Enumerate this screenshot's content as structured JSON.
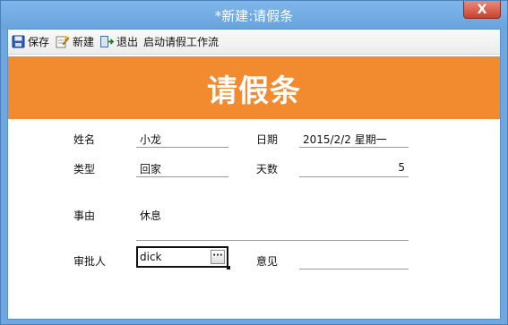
{
  "window": {
    "title": "*新建:请假条",
    "close_label": "X"
  },
  "toolbar": {
    "save_label": "保存",
    "new_label": "新建",
    "exit_label": "退出",
    "start_label": "启动请假工作流"
  },
  "banner": {
    "title": "请假条"
  },
  "form": {
    "name": {
      "label": "姓名",
      "value": "小龙"
    },
    "date": {
      "label": "日期",
      "value": "2015/2/2 星期一"
    },
    "type": {
      "label": "类型",
      "value": "回家"
    },
    "days": {
      "label": "天数",
      "value": "5"
    },
    "reason": {
      "label": "事由",
      "value": "休息"
    },
    "approver": {
      "label": "审批人",
      "value": "dick",
      "lookup_label": "···"
    },
    "opinion": {
      "label": "意见",
      "value": ""
    }
  }
}
